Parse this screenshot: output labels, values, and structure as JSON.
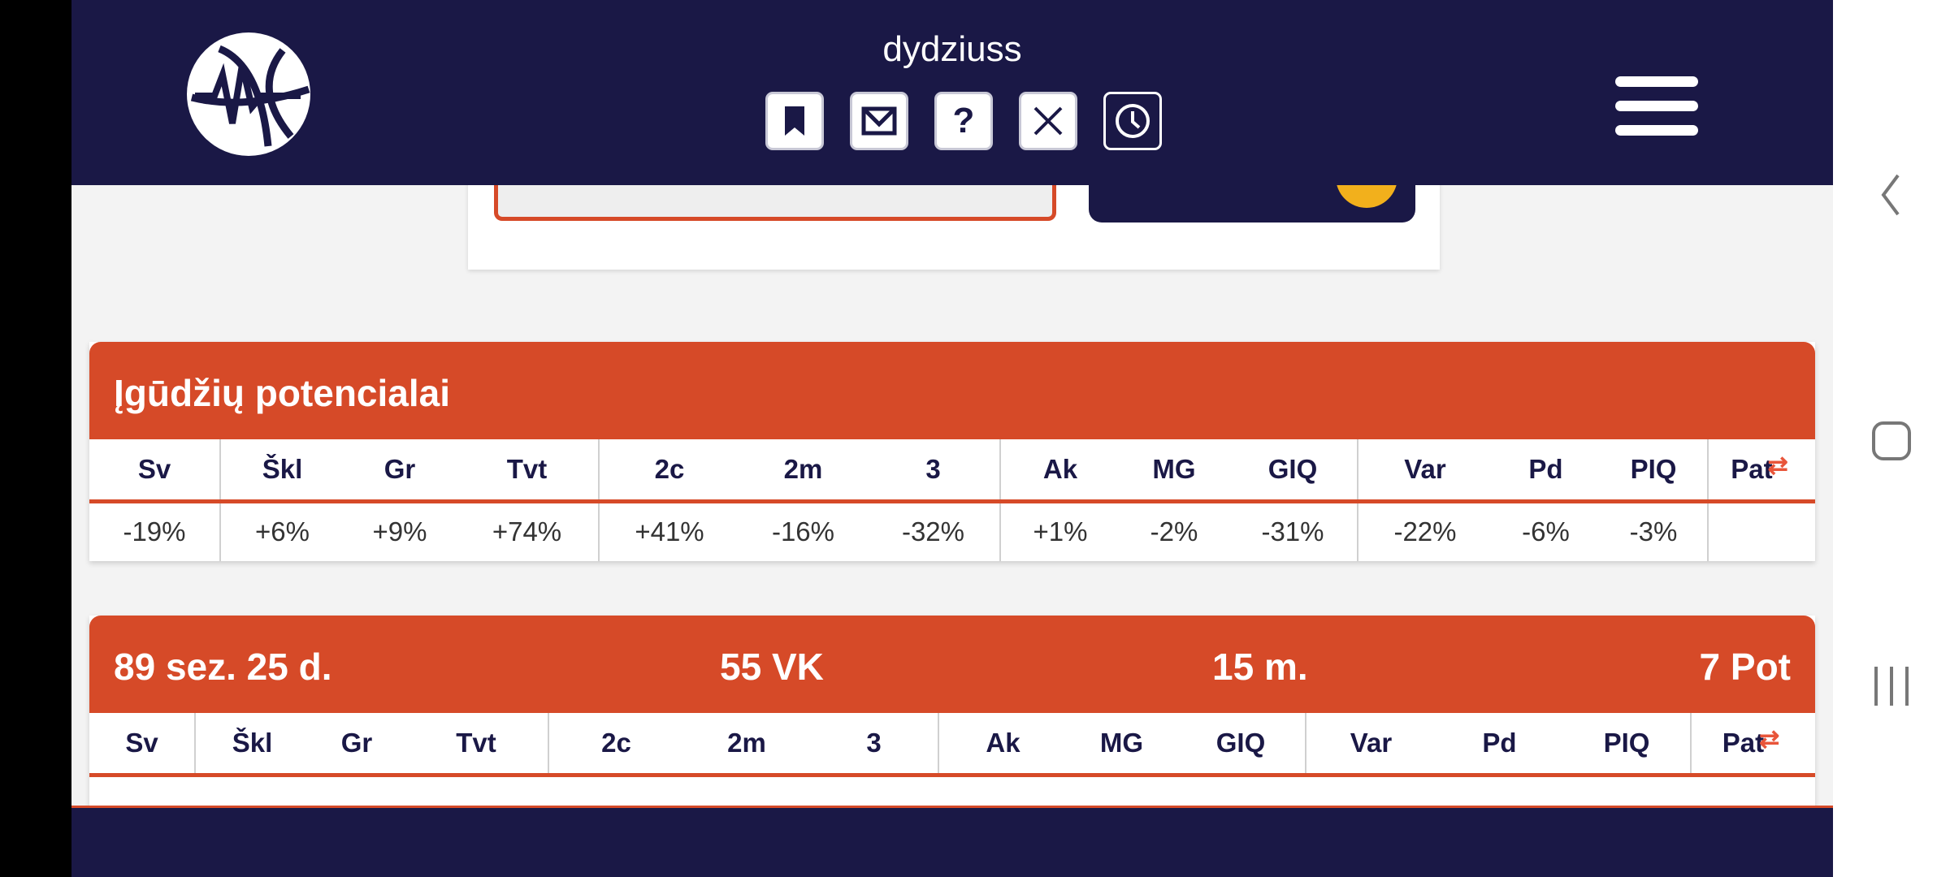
{
  "header": {
    "username": "dydziuss",
    "buttons": [
      {
        "name": "bookmark-icon"
      },
      {
        "name": "mail-icon"
      },
      {
        "name": "help-icon",
        "label": "?"
      },
      {
        "name": "close-icon"
      },
      {
        "name": "clock-icon"
      }
    ]
  },
  "skills_panel": {
    "title": "Įgūdžių potencialai",
    "columns": [
      "Sv",
      "Škl",
      "Gr",
      "Tvt",
      "2c",
      "2m",
      "3",
      "Ak",
      "MG",
      "GIQ",
      "Var",
      "Pd",
      "PIQ",
      "Pat"
    ],
    "values": [
      "-19%",
      "+6%",
      "+9%",
      "+74%",
      "+41%",
      "-16%",
      "-32%",
      "+1%",
      "-2%",
      "-31%",
      "-22%",
      "-6%",
      "-3%",
      ""
    ]
  },
  "player_panel": {
    "date": "89 sez. 25 d.",
    "height": "55 VK",
    "age": "15 m.",
    "potential": "7 Pot",
    "columns": [
      "Sv",
      "Škl",
      "Gr",
      "Tvt",
      "2c",
      "2m",
      "3",
      "Ak",
      "MG",
      "GIQ",
      "Var",
      "Pd",
      "PIQ",
      "Pat"
    ]
  },
  "colors": {
    "navy": "#1a1846",
    "accent": "#d64a28"
  }
}
